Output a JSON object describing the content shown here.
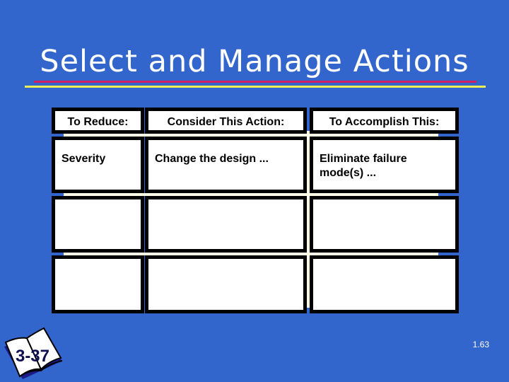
{
  "slide": {
    "title": "Select and Manage Actions",
    "colors": {
      "background": "#3366cc",
      "rule_magenta": "#cc2266",
      "rule_yellow": "#eeee55"
    },
    "table": {
      "headers": [
        "To Reduce:",
        "Consider This Action:",
        "To Accomplish This:"
      ],
      "rows": [
        [
          "Severity",
          "Change the design ...",
          "Eliminate failure mode(s) ..."
        ],
        [
          "",
          "",
          ""
        ],
        [
          "",
          "",
          ""
        ]
      ]
    },
    "book_icon": {
      "icon": "open-book-icon",
      "label": "3-37"
    },
    "page_number": "1.63"
  }
}
